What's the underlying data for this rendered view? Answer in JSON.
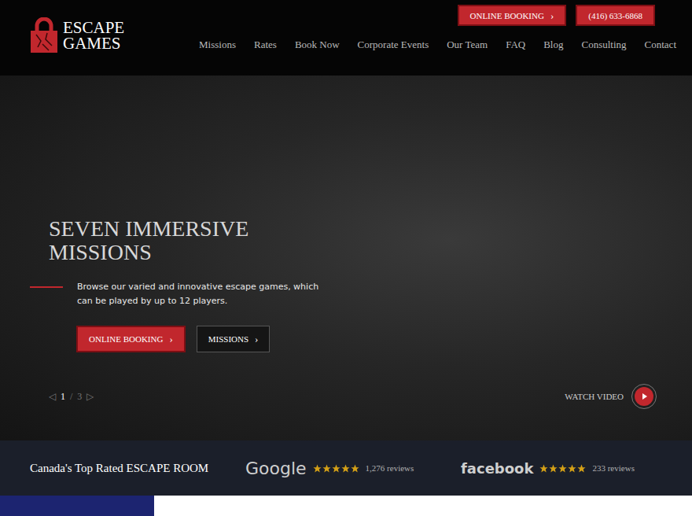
{
  "logo": {
    "line1": "ESCAPE",
    "line2": "GAMES"
  },
  "top_buttons": [
    {
      "label": "ONLINE BOOKING",
      "arrow": "›"
    },
    {
      "label": "(416) 633-6868",
      "arrow": ""
    }
  ],
  "nav": [
    "Missions",
    "Rates",
    "Book Now",
    "Corporate Events",
    "Our Team",
    "FAQ",
    "Blog",
    "Consulting",
    "Contact"
  ],
  "hero": {
    "title": "SEVEN IMMERSIVE MISSIONS",
    "description": "Browse our varied and innovative escape games, which can be played by up to 12 players.",
    "buttons": [
      {
        "label": "ONLINE BOOKING",
        "arrow": "›",
        "kind": "primary"
      },
      {
        "label": "MISSIONS",
        "arrow": "›",
        "kind": "outline"
      }
    ],
    "slider": {
      "prev": "◁",
      "current": "1",
      "separator": "/",
      "total": "3",
      "next": "▷"
    },
    "video": {
      "label": "WATCH VIDEO"
    }
  },
  "reviews": {
    "tagline": "Canada's Top Rated ESCAPE ROOM",
    "sources": [
      {
        "name": "Google",
        "stars": 5,
        "count": "1,276 reviews"
      },
      {
        "name": "facebook",
        "stars": 5,
        "count": "233 reviews"
      }
    ]
  }
}
